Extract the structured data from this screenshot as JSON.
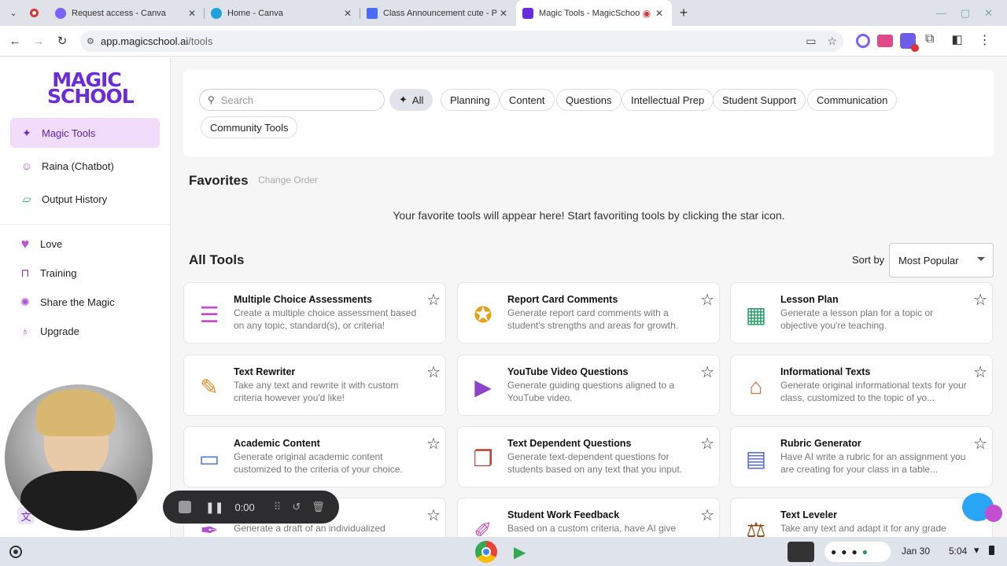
{
  "browser": {
    "tabs": [
      {
        "title": "Request access - Canva",
        "color": "#7b61ff"
      },
      {
        "title": "Home - Canva",
        "color": "#1fa2d9"
      },
      {
        "title": "Class Announcement cute - Po...",
        "color": "#4a6cf7"
      },
      {
        "title": "Magic Tools - MagicSchool",
        "color": "#6c2bd9"
      }
    ],
    "url_host": "app.magicschool.ai",
    "url_path": "/tools"
  },
  "sidebar": {
    "logo_line1": "MAGIC",
    "logo_line2": "SCHOOL",
    "items": [
      {
        "label": "Magic Tools",
        "icon": "wizard-icon"
      },
      {
        "label": "Raina (Chatbot)",
        "icon": "robot-icon"
      },
      {
        "label": "Output History",
        "icon": "history-icon"
      },
      {
        "label": "Love",
        "icon": "heart-icon"
      },
      {
        "label": "Training",
        "icon": "easel-icon"
      },
      {
        "label": "Share the Magic",
        "icon": "sparkle-icon"
      },
      {
        "label": "Upgrade",
        "icon": "potion-icon"
      }
    ]
  },
  "filters": {
    "search_placeholder": "Search",
    "chips": [
      "All",
      "Planning",
      "Content",
      "Questions",
      "Intellectual Prep",
      "Student Support",
      "Communication",
      "Community Tools"
    ]
  },
  "favorites": {
    "title": "Favorites",
    "change_order": "Change Order",
    "empty_message": "Your favorite tools will appear here! Start favoriting tools by clicking the star icon."
  },
  "all_tools": {
    "title": "All Tools",
    "sort_label": "Sort by",
    "sort_value": "Most Popular"
  },
  "cards": [
    {
      "title": "Multiple Choice Assessments",
      "desc": "Create a multiple choice assessment based on any topic, standard(s), or criteria!",
      "icon": "checklist-icon",
      "color": "#c24fd1"
    },
    {
      "title": "Report Card Comments",
      "desc": "Generate report card comments with a student's strengths and areas for growth.",
      "icon": "medal-icon",
      "color": "#e0a31a"
    },
    {
      "title": "Lesson Plan",
      "desc": "Generate a lesson plan for a topic or objective you're teaching.",
      "icon": "chalkboard-icon",
      "color": "#2f9e6b"
    },
    {
      "title": "Text Rewriter",
      "desc": "Take any text and rewrite it with custom criteria however you'd like!",
      "icon": "pencil-icon",
      "color": "#f08a24"
    },
    {
      "title": "YouTube Video Questions",
      "desc": "Generate guiding questions aligned to a YouTube video.",
      "icon": "video-camera-icon",
      "color": "#8e44c9"
    },
    {
      "title": "Informational Texts",
      "desc": "Generate original informational texts for your class, customized to the topic of yo...",
      "icon": "colosseum-icon",
      "color": "#d46a3b"
    },
    {
      "title": "Academic Content",
      "desc": "Generate original academic content customized to the criteria of your choice.",
      "icon": "laptop-icon",
      "color": "#4a7bd8"
    },
    {
      "title": "Text Dependent Questions",
      "desc": "Generate text-dependent questions for students based on any text that you input.",
      "icon": "open-book-icon",
      "color": "#c0392b"
    },
    {
      "title": "Rubric Generator",
      "desc": "Have AI write a rubric for an assignment you are creating for your class in a table...",
      "icon": "notebook-icon",
      "color": "#5b6cd9"
    },
    {
      "title": "",
      "desc": "Generate a draft of an individualized",
      "icon": "pen-icon",
      "color": "#b04fd1"
    },
    {
      "title": "Student Work Feedback",
      "desc": "Based on a custom criteria, have AI give",
      "icon": "marker-icon",
      "color": "#d64fb5"
    },
    {
      "title": "Text Leveler",
      "desc": "Take any text and adapt it for any grade",
      "icon": "scale-icon",
      "color": "#8b4513"
    }
  ],
  "recorder": {
    "time": "0:00"
  },
  "shelf": {
    "date": "Jan 30",
    "time": "5:04"
  }
}
